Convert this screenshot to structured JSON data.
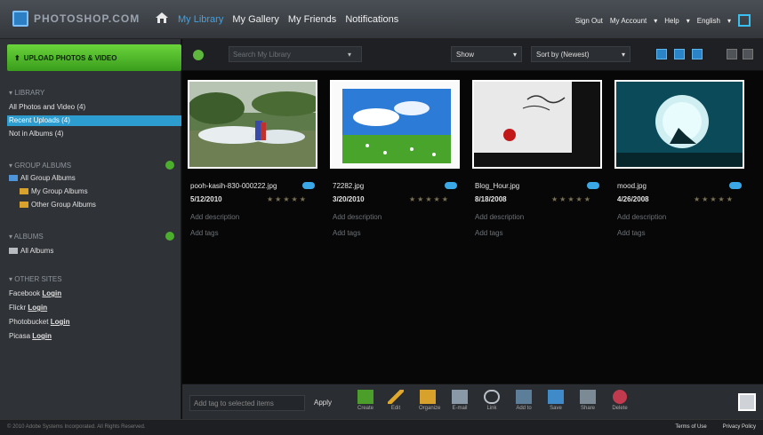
{
  "header": {
    "logo": "PHOTOSHOP.COM",
    "nav": [
      "My Library",
      "My Gallery",
      "My Friends",
      "Notifications"
    ],
    "util": {
      "sign_out": "Sign Out",
      "account": "My Account",
      "help": "Help",
      "language": "English"
    }
  },
  "sidebar": {
    "upload_label": "UPLOAD PHOTOS & VIDEO",
    "library_header": "LIBRARY",
    "library_items": [
      "All Photos and Video (4)",
      "Recent Uploads (4)",
      "Not in Albums (4)"
    ],
    "group_header": "GROUP ALBUMS",
    "group_items": [
      "All Group Albums",
      "My Group Albums",
      "Other Group Albums"
    ],
    "albums_header": "ALBUMS",
    "albums_items": [
      "All Albums"
    ],
    "other_header": "OTHER SITES",
    "other_sites": [
      {
        "name": "Facebook",
        "link": "Login"
      },
      {
        "name": "Flickr",
        "link": "Login"
      },
      {
        "name": "Photobucket",
        "link": "Login"
      },
      {
        "name": "Picasa",
        "link": "Login"
      }
    ]
  },
  "toolbar": {
    "search_placeholder": "Search My Library",
    "show_label": "Show",
    "sort_label": "Sort by (Newest)"
  },
  "photos": [
    {
      "name": "pooh-kasih-830-000222.jpg",
      "date": "5/12/2010",
      "desc": "Add description",
      "tags": "Add tags"
    },
    {
      "name": "72282.jpg",
      "date": "3/20/2010",
      "desc": "Add description",
      "tags": "Add tags"
    },
    {
      "name": "Blog_Hour.jpg",
      "date": "8/18/2008",
      "desc": "Add description",
      "tags": "Add tags"
    },
    {
      "name": "mood.jpg",
      "date": "4/26/2008",
      "desc": "Add description",
      "tags": "Add tags"
    }
  ],
  "bottom": {
    "tag_placeholder": "Add tag to selected items",
    "apply": "Apply",
    "tools": [
      "Create",
      "Edit",
      "Organize",
      "E-mail",
      "Link",
      "Add to",
      "Save",
      "Share",
      "Delete"
    ]
  },
  "footer": {
    "copyright": "© 2010 Adobe Systems Incorporated. All Rights Reserved.",
    "terms": "Terms of Use",
    "privacy": "Privacy Policy"
  }
}
